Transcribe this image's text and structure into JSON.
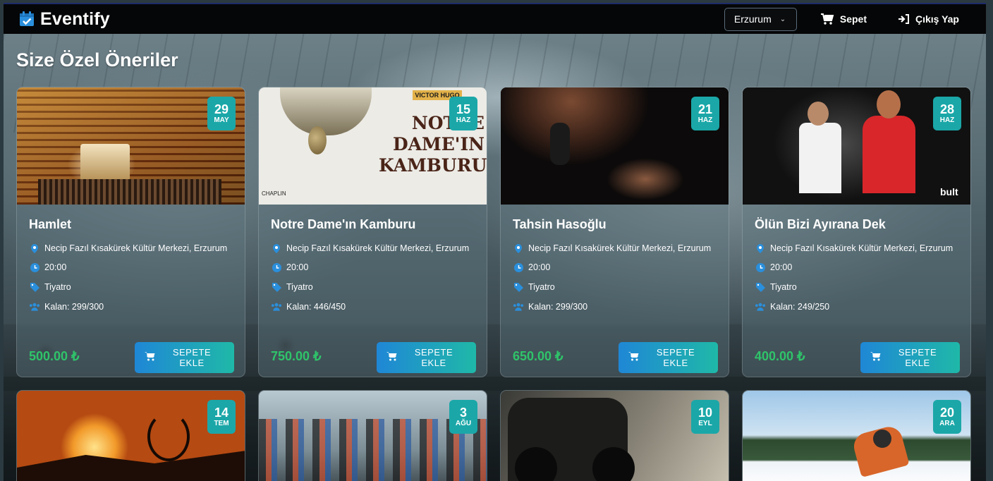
{
  "app": {
    "title": "Eventify"
  },
  "nav": {
    "city": "Erzurum",
    "cart_label": "Sepet",
    "logout_label": "Çıkış Yap"
  },
  "section": {
    "title": "Size Özel Öneriler"
  },
  "colors": {
    "accent": "#1ba7a8",
    "price": "#2fc46a",
    "icon_blue": "#2a8fdc",
    "nav_bg": "#050607"
  },
  "cards": [
    {
      "day": "29",
      "month": "MAY",
      "title": "Hamlet",
      "venue": "Necip Fazıl Kısakürek Kültür Merkezi, Erzurum",
      "time": "20:00",
      "category": "Tiyatro",
      "remaining": "Kalan: 299/300",
      "price": "500.00 ₺",
      "button_line1": "SEPETE",
      "button_line2": "EKLE"
    },
    {
      "day": "15",
      "month": "HAZ",
      "title": "Notre Dame'ın Kamburu",
      "venue": "Necip Fazıl Kısakürek Kültür Merkezi, Erzurum",
      "time": "20:00",
      "category": "Tiyatro",
      "remaining": "Kalan: 446/450",
      "price": "750.00 ₺",
      "button_line1": "SEPETE",
      "button_line2": "EKLE",
      "poster_tag": "VICTOR HUGO",
      "poster_title": "NOTRE DAME'IN KAMBURU",
      "poster_credit": "CHAPLIN"
    },
    {
      "day": "21",
      "month": "HAZ",
      "title": "Tahsin Hasoğlu",
      "venue": "Necip Fazıl Kısakürek Kültür Merkezi, Erzurum",
      "time": "20:00",
      "category": "Tiyatro",
      "remaining": "Kalan: 299/300",
      "price": "650.00 ₺",
      "button_line1": "SEPETE",
      "button_line2": "EKLE"
    },
    {
      "day": "28",
      "month": "HAZ",
      "title": "Ölün Bizi Ayırana Dek",
      "venue": "Necip Fazıl Kısakürek Kültür Merkezi, Erzurum",
      "time": "20:00",
      "category": "Tiyatro",
      "remaining": "Kalan: 249/250",
      "price": "400.00 ₺",
      "button_line1": "SEPETE",
      "button_line2": "EKLE",
      "poster_logo": "bult"
    },
    {
      "day": "14",
      "month": "TEM"
    },
    {
      "day": "3",
      "month": "AĞU"
    },
    {
      "day": "10",
      "month": "EYL"
    },
    {
      "day": "20",
      "month": "ARA"
    }
  ]
}
